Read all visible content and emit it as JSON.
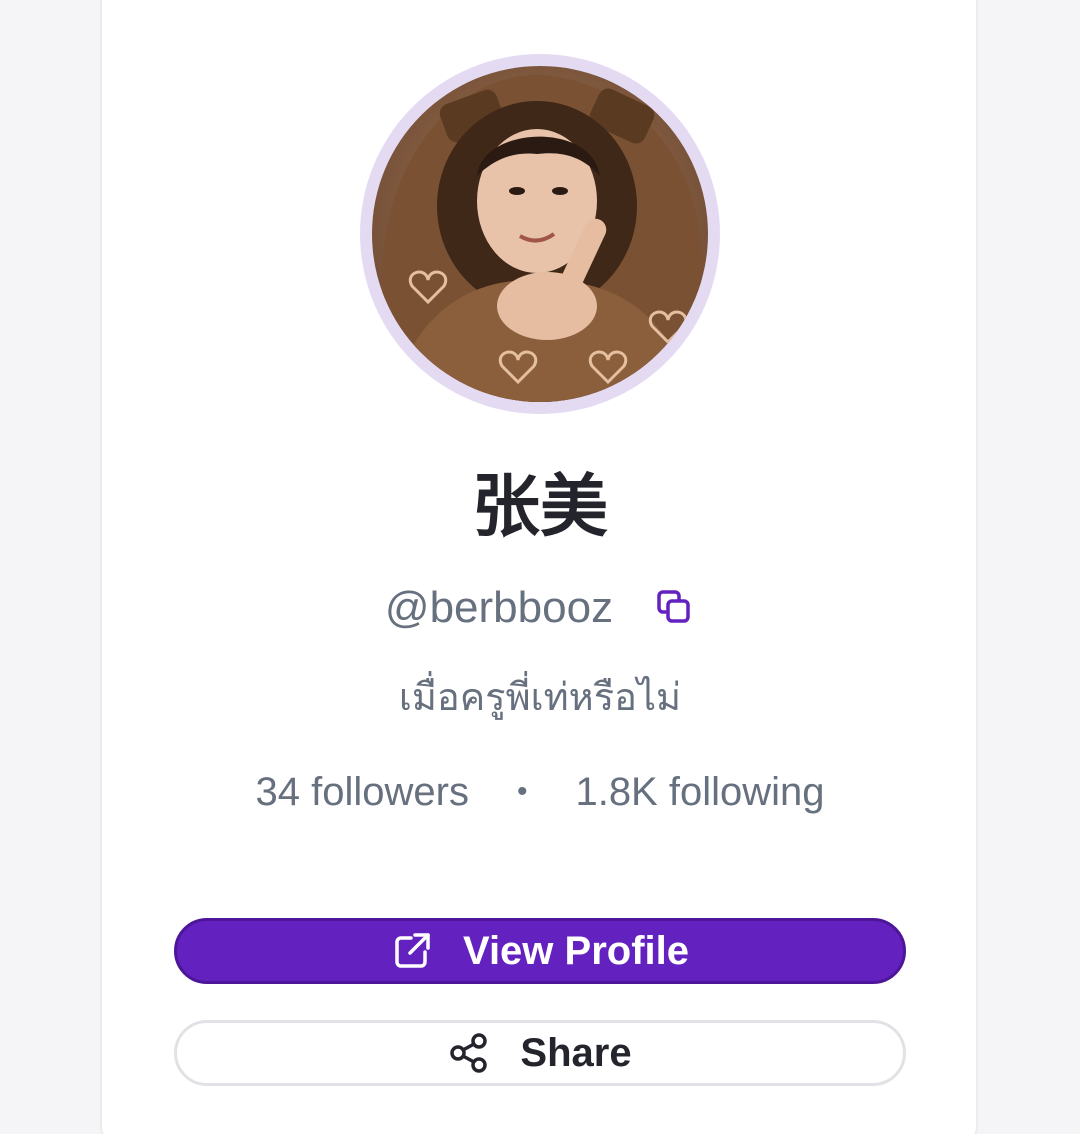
{
  "profile": {
    "name": "张美",
    "handle": "@berbbooz",
    "bio": "เมื่อครูพี่เท่หรือไม่",
    "followers_label": "34 followers",
    "separator": "•",
    "following_label": "1.8K following"
  },
  "actions": {
    "view_profile_label": "View Profile",
    "share_label": "Share"
  },
  "colors": {
    "accent": "#6321bf",
    "avatar_ring": "#e4dbf3",
    "muted_text": "#67707f",
    "title_text": "#24242c"
  },
  "icons": {
    "copy": "copy-icon",
    "external_link": "external-link-icon",
    "share": "share-icon"
  }
}
